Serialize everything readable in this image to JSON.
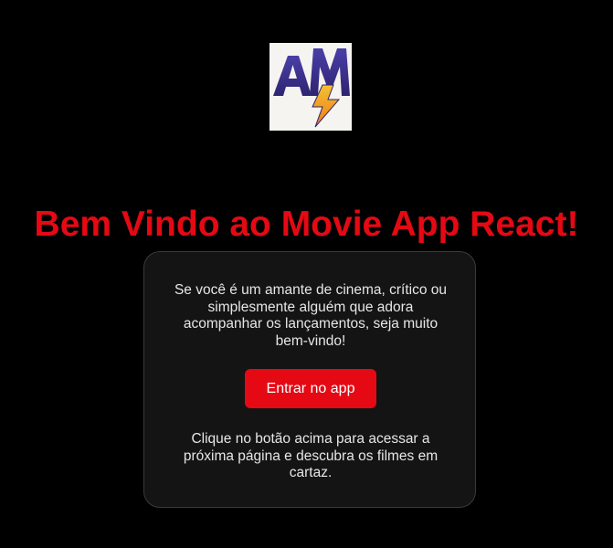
{
  "logo": {
    "text": "AM",
    "icon": "lightning-bolt-icon",
    "colors": {
      "letters": "#3b2f8f",
      "bolt_top": "#f2c230",
      "bolt_bottom": "#f07a1a"
    }
  },
  "header": {
    "title": "Bem Vindo ao Movie App React!"
  },
  "card": {
    "intro_text": "Se você é um amante de cinema, crítico ou simplesmente alguém que adora acompanhar os lançamentos, seja muito bem-vindo!",
    "enter_button_label": "Entrar no app",
    "hint_text": "Clique no botão acima para acessar a próxima página e descubra os filmes em cartaz."
  },
  "colors": {
    "background": "#000000",
    "accent": "#e50914",
    "card_background": "#141414",
    "card_border": "#3a3a3a",
    "text": "#e6e6e6"
  }
}
